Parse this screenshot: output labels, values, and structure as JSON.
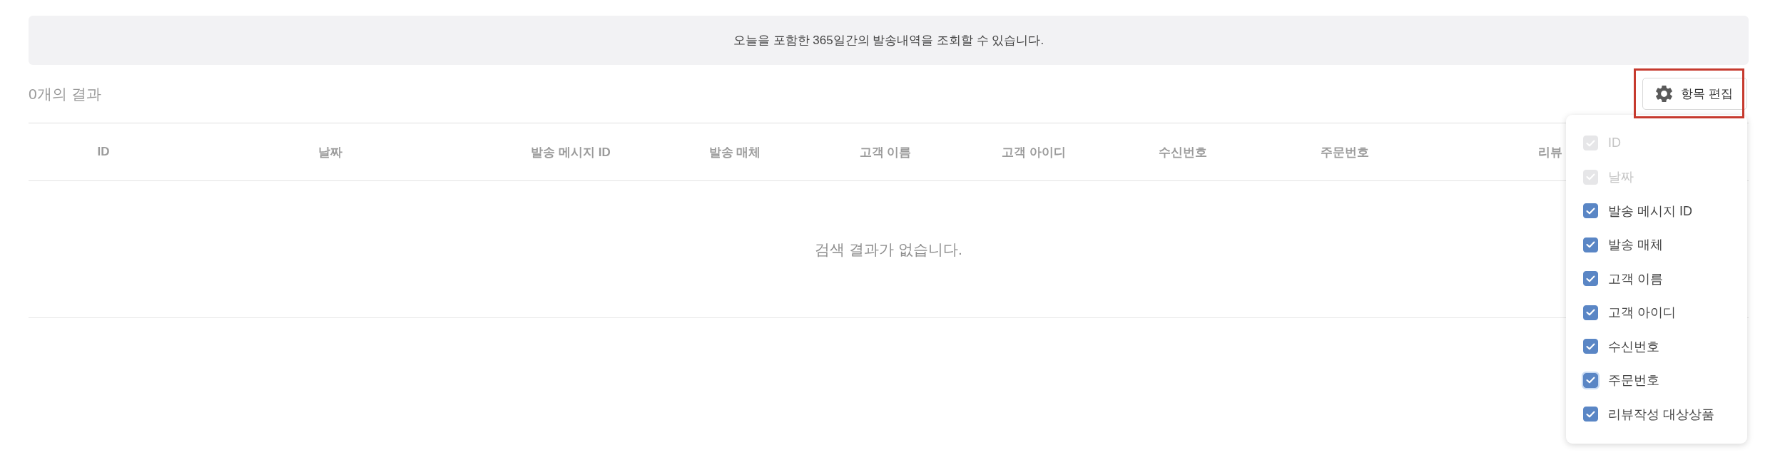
{
  "notice": {
    "text": "오늘을 포함한 365일간의 발송내역을 조회할 수 있습니다."
  },
  "results": {
    "count_label": "0개의 결과"
  },
  "edit_columns_button": {
    "label": "항목 편집",
    "highlighted": true
  },
  "table": {
    "columns": [
      {
        "label": "ID"
      },
      {
        "label": "날짜"
      },
      {
        "label": "발송 메시지 ID"
      },
      {
        "label": "발송 매체"
      },
      {
        "label": "고객 이름"
      },
      {
        "label": "고객 아이디"
      },
      {
        "label": "수신번호"
      },
      {
        "label": "주문번호"
      },
      {
        "label": "리뷰"
      }
    ],
    "empty_message": "검색 결과가 없습니다."
  },
  "column_menu": {
    "open": true,
    "items": [
      {
        "label": "ID",
        "checked": true,
        "disabled": true,
        "focused": false
      },
      {
        "label": "날짜",
        "checked": true,
        "disabled": true,
        "focused": false
      },
      {
        "label": "발송 메시지 ID",
        "checked": true,
        "disabled": false,
        "focused": false
      },
      {
        "label": "발송 매체",
        "checked": true,
        "disabled": false,
        "focused": false
      },
      {
        "label": "고객 이름",
        "checked": true,
        "disabled": false,
        "focused": false
      },
      {
        "label": "고객 아이디",
        "checked": true,
        "disabled": false,
        "focused": false
      },
      {
        "label": "수신번호",
        "checked": true,
        "disabled": false,
        "focused": false
      },
      {
        "label": "주문번호",
        "checked": true,
        "disabled": false,
        "focused": true
      },
      {
        "label": "리뷰작성 대상상품",
        "checked": true,
        "disabled": false,
        "focused": false
      }
    ]
  }
}
